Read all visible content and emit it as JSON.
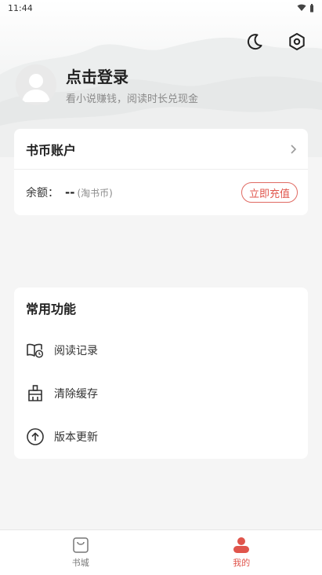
{
  "status_bar": {
    "time": "11:44"
  },
  "header": {
    "login_title": "点击登录",
    "login_subtitle": "看小说赚钱，阅读时长兑现金"
  },
  "account": {
    "title": "书币账户",
    "balance_label": "余额：",
    "balance_value": "--",
    "balance_unit": "(淘书币)",
    "recharge_label": "立即充值"
  },
  "functions": {
    "title": "常用功能",
    "items": [
      {
        "label": "阅读记录",
        "icon": "reading-history-icon"
      },
      {
        "label": "清除缓存",
        "icon": "broom-icon"
      },
      {
        "label": "版本更新",
        "icon": "cloud-upload-icon"
      }
    ]
  },
  "tabbar": {
    "tabs": [
      {
        "label": "书城",
        "icon": "shopping-bag-icon",
        "active": false
      },
      {
        "label": "我的",
        "icon": "user-icon",
        "active": true
      }
    ]
  },
  "colors": {
    "accent": "#e0554c",
    "background": "#f5f5f5"
  }
}
